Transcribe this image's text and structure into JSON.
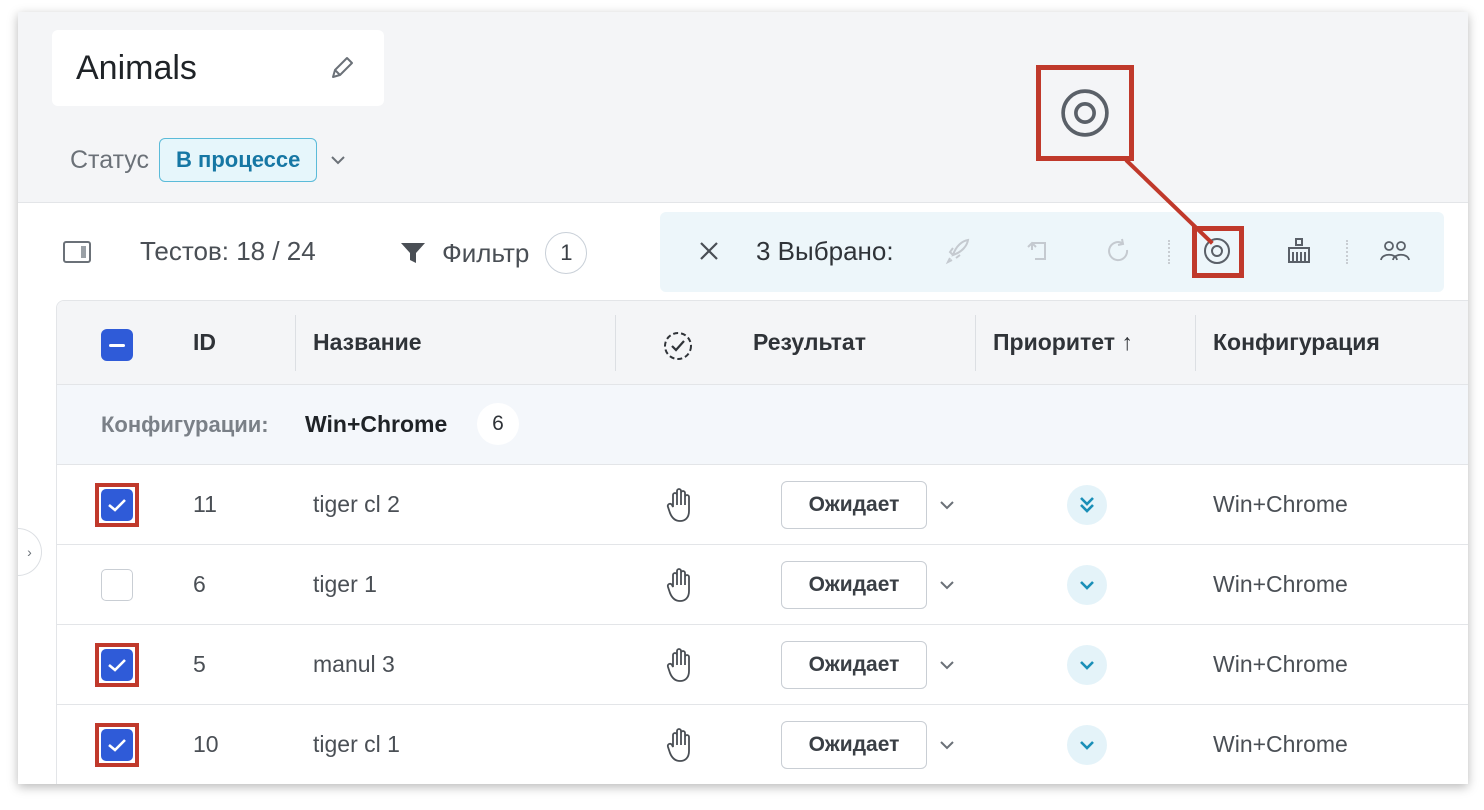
{
  "header": {
    "title": "Animals",
    "status_label": "Статус",
    "status_value": "В процессе"
  },
  "toolbar": {
    "tests_count": "Тестов: 18 / 24",
    "filter_label": "Фильтр",
    "filter_count": "1",
    "selected_text": "3 Выбрано:"
  },
  "table": {
    "headers": {
      "id": "ID",
      "name": "Название",
      "result": "Результат",
      "priority": "Приоритет ↑",
      "configuration": "Конфигурация"
    },
    "group": {
      "label": "Конфигурации:",
      "value": "Win+Chrome",
      "count": "6"
    },
    "rows": [
      {
        "id": "11",
        "name": "tiger cl 2",
        "result": "Ожидает",
        "config": "Win+Chrome",
        "checked": true,
        "priority": "lowest"
      },
      {
        "id": "6",
        "name": "tiger 1",
        "result": "Ожидает",
        "config": "Win+Chrome",
        "checked": false,
        "priority": "low"
      },
      {
        "id": "5",
        "name": "manul 3",
        "result": "Ожидает",
        "config": "Win+Chrome",
        "checked": true,
        "priority": "low"
      },
      {
        "id": "10",
        "name": "tiger cl 1",
        "result": "Ожидает",
        "config": "Win+Chrome",
        "checked": true,
        "priority": "low"
      }
    ]
  },
  "colors": {
    "accent": "#2f5bd8",
    "status_text": "#1677a4",
    "highlight": "#c0392b",
    "priority": "#1a8fb8"
  },
  "icons": [
    "edit-icon",
    "chevron-down-icon",
    "sidebar-toggle-icon",
    "filter-icon",
    "close-icon",
    "rocket-icon",
    "reassign-icon",
    "redo-icon",
    "target-icon",
    "broom-icon",
    "users-icon",
    "hand-icon",
    "priority-icon"
  ]
}
